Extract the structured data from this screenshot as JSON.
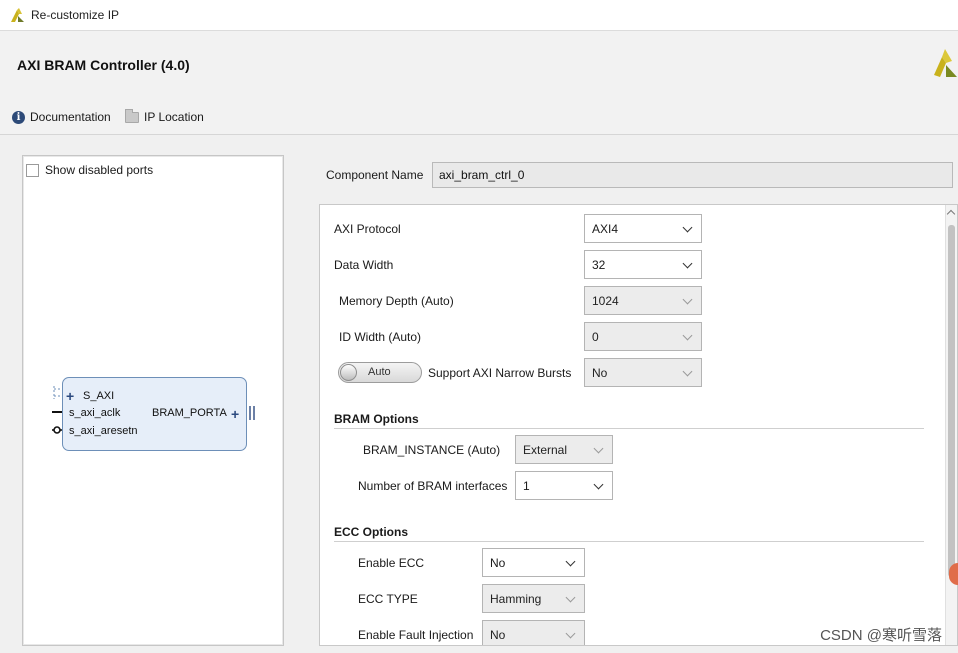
{
  "window": {
    "title": "Re-customize IP"
  },
  "header": {
    "ip_title": "AXI BRAM Controller (4.0)",
    "documentation_label": "Documentation",
    "ip_location_label": "IP Location"
  },
  "symbol_panel": {
    "show_disabled_ports_label": "Show disabled ports",
    "block": {
      "left_ports": [
        "S_AXI",
        "s_axi_aclk",
        "s_axi_aresetn"
      ],
      "right_port": "BRAM_PORTA"
    }
  },
  "component": {
    "label": "Component Name",
    "value": "axi_bram_ctrl_0"
  },
  "config": {
    "axi_protocol": {
      "label": "AXI Protocol",
      "value": "AXI4"
    },
    "data_width": {
      "label": "Data Width",
      "value": "32"
    },
    "memory_depth": {
      "label": "Memory Depth (Auto)",
      "value": "1024"
    },
    "id_width": {
      "label": "ID Width (Auto)",
      "value": "0"
    },
    "narrow_bursts": {
      "toggle_label": "Auto",
      "label": "Support AXI Narrow Bursts",
      "value": "No"
    },
    "bram_section": "BRAM Options",
    "bram_instance": {
      "label": "BRAM_INSTANCE (Auto)",
      "value": "External"
    },
    "num_bram_interfaces": {
      "label": "Number of BRAM interfaces",
      "value": "1"
    },
    "ecc_section": "ECC Options",
    "enable_ecc": {
      "label": "Enable ECC",
      "value": "No"
    },
    "ecc_type": {
      "label": "ECC TYPE",
      "value": "Hamming"
    },
    "fault_injection": {
      "label": "Enable Fault Injection",
      "value": "No"
    }
  },
  "watermark": "CSDN @寒听雪落",
  "colors": {
    "accent": "#2c4a80",
    "logo_yellow": "#c9b21c",
    "block_fill": "#e6eef9"
  },
  "icons": [
    "xilinx-logo-icon",
    "info-icon",
    "folder-icon",
    "checkbox-icon",
    "chevron-down-icon"
  ]
}
